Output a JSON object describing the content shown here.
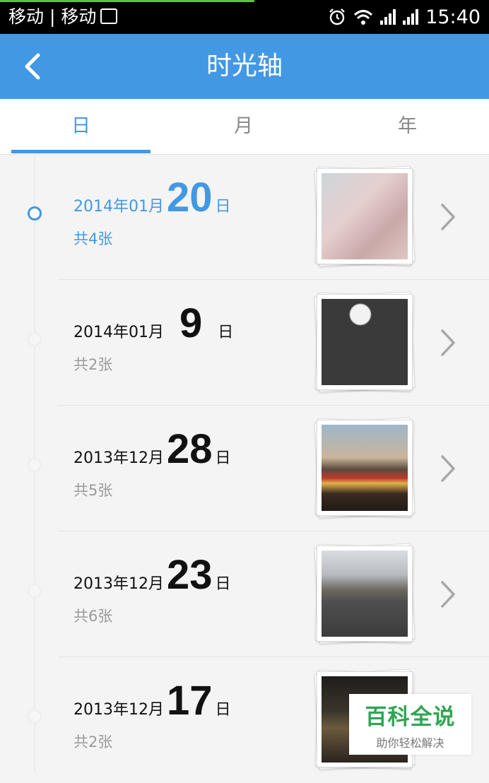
{
  "status_bar": {
    "carrier": "移动 | 移动",
    "time": "15:40",
    "icons": [
      "gallery-icon",
      "alarm-icon",
      "wifi-icon",
      "signal-icon",
      "signal-icon"
    ]
  },
  "header": {
    "title": "时光轴",
    "back_icon": "chevron-left-icon"
  },
  "tabs": [
    {
      "label": "日",
      "active": true
    },
    {
      "label": "月",
      "active": false
    },
    {
      "label": "年",
      "active": false
    }
  ],
  "timeline": [
    {
      "year_month": "2014年01月",
      "day": "20",
      "day_suffix": "日",
      "count": "共4张",
      "current": true
    },
    {
      "year_month": "2014年01月",
      "day": "9",
      "day_suffix": "日",
      "count": "共2张",
      "current": false
    },
    {
      "year_month": "2013年12月",
      "day": "28",
      "day_suffix": "日",
      "count": "共5张",
      "current": false
    },
    {
      "year_month": "2013年12月",
      "day": "23",
      "day_suffix": "日",
      "count": "共6张",
      "current": false
    },
    {
      "year_month": "2013年12月",
      "day": "17",
      "day_suffix": "日",
      "count": "共2张",
      "current": false
    }
  ],
  "watermark": {
    "title": "百科全说",
    "subtitle": "助你轻松解决"
  },
  "colors": {
    "accent": "#4398e3",
    "brand_green": "#2fa552"
  }
}
